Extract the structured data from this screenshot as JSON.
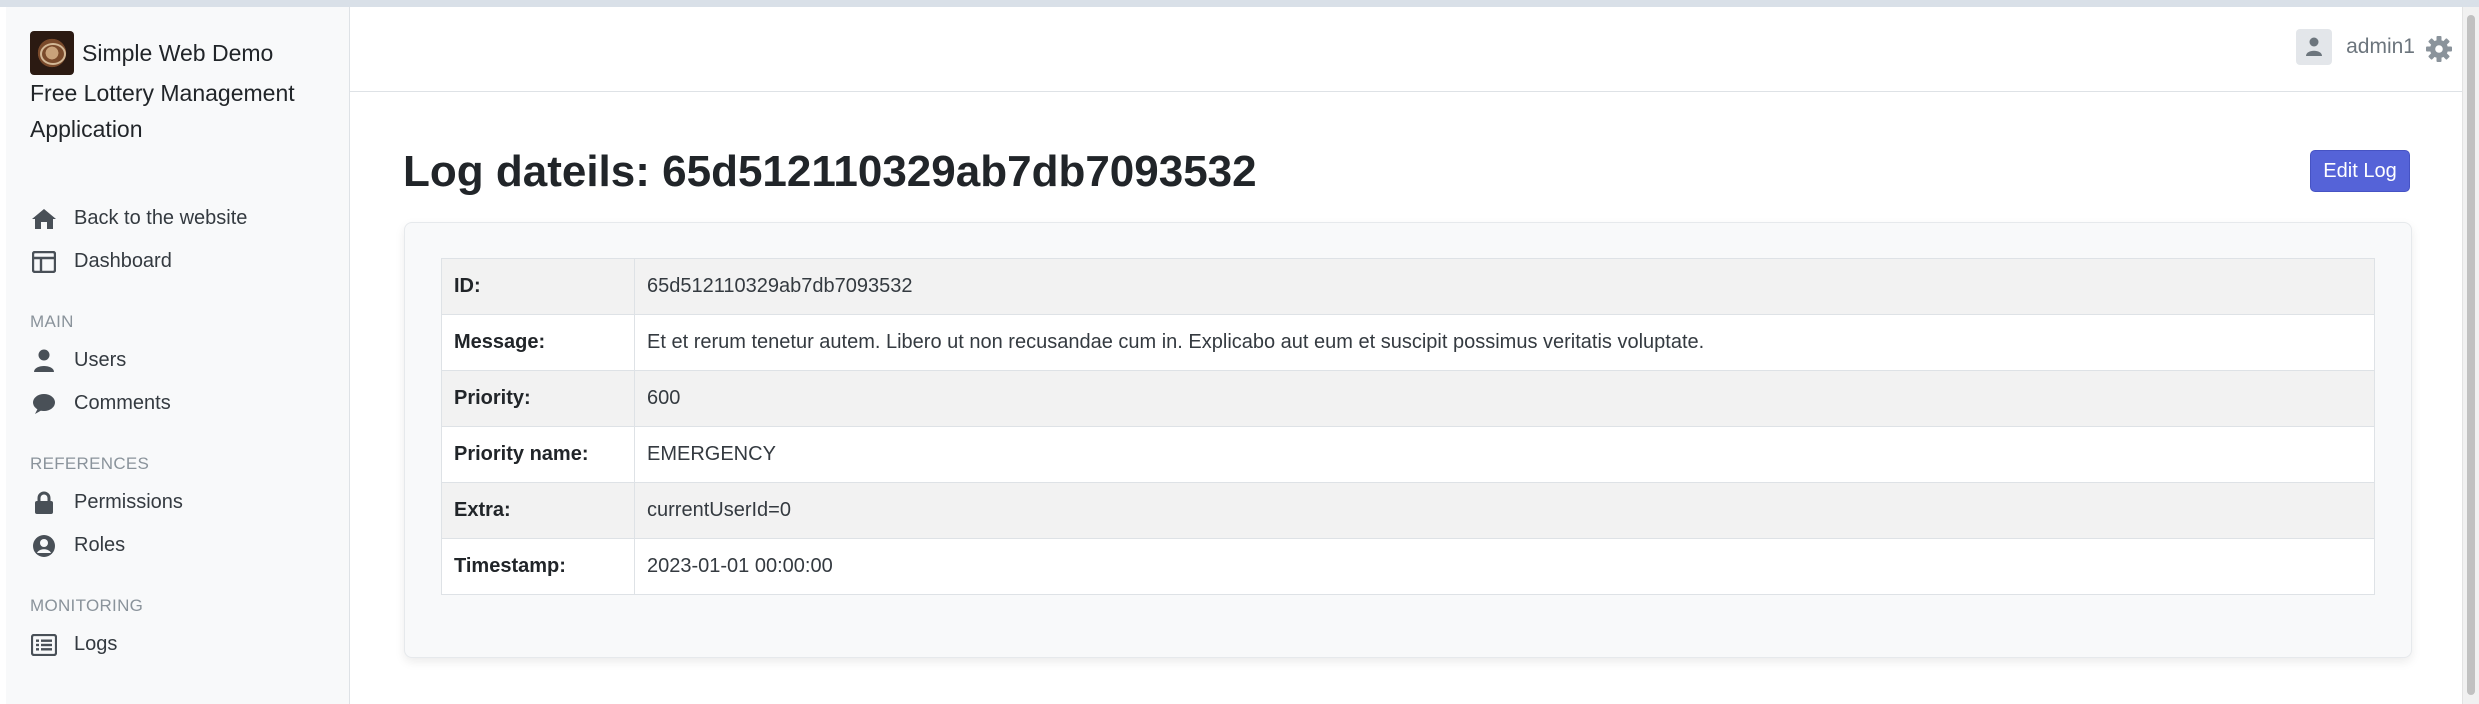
{
  "brand": {
    "title": "Simple Web Demo",
    "subtitle": "Free Lottery Management Application"
  },
  "sidebar": {
    "top_items": [
      {
        "label": "Back to the website",
        "icon": "home-icon"
      },
      {
        "label": "Dashboard",
        "icon": "dashboard-icon"
      }
    ],
    "sections": [
      {
        "title": "MAIN",
        "items": [
          {
            "label": "Users",
            "icon": "user-icon"
          },
          {
            "label": "Comments",
            "icon": "comment-icon"
          }
        ]
      },
      {
        "title": "REFERENCES",
        "items": [
          {
            "label": "Permissions",
            "icon": "lock-icon"
          },
          {
            "label": "Roles",
            "icon": "user-circle-icon"
          }
        ]
      },
      {
        "title": "MONITORING",
        "items": [
          {
            "label": "Logs",
            "icon": "list-icon"
          }
        ]
      }
    ]
  },
  "header": {
    "username": "admin1"
  },
  "page": {
    "title": "Log dateils: 65d512110329ab7db7093532",
    "edit_label": "Edit Log"
  },
  "details": [
    {
      "label": "ID:",
      "value": "65d512110329ab7db7093532"
    },
    {
      "label": "Message:",
      "value": "Et et rerum tenetur autem. Libero ut non recusandae cum in. Explicabo aut eum et suscipit possimus veritatis voluptate."
    },
    {
      "label": "Priority:",
      "value": "600"
    },
    {
      "label": "Priority name:",
      "value": "EMERGENCY"
    },
    {
      "label": "Extra:",
      "value": "currentUserId=0"
    },
    {
      "label": "Timestamp:",
      "value": "2023-01-01 00:00:00"
    }
  ],
  "colors": {
    "accent": "#5563d8",
    "sidebar_bg": "#f8f9fa"
  }
}
